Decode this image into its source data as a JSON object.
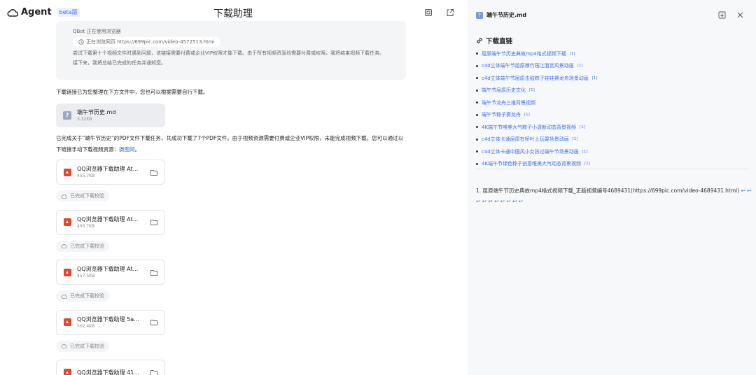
{
  "header": {
    "app_name": "Agent",
    "badge": "beta版",
    "title": "下载助理"
  },
  "chat": {
    "thought": {
      "status": "QBot 正在使用浏览器",
      "browsing": "正在浏览网页 https://699pic.com/video-4572513.html",
      "line1": "尝试下载第十个视频文件时遇到问题，该链接需要付费或企业VIP权限才能下载。由于所有视频资源均需要付费或权限，我将结束视频下载任务。",
      "line2": "接下来，我将总结已完成的任务并通知您。"
    },
    "msg1": "下载链接已为您整理在下方文件中，您也可以根据需要自行下载。",
    "file": {
      "name": "端午节历史.md",
      "size": "3.32KB"
    },
    "msg2": "已完成关于“端午节历史”的PDF文件下载任务，共成功下载了7个PDF文件。由于视频资源需要付费或企业VIP权限，未能完成视频下载。您可以通过以下链接手动下载视频资源：",
    "msg2_link": "摄图网",
    "msg2_end": "。",
    "verify_label": "已完成下载校验",
    "attachments": [
      {
        "name": "QQ浏览器下载助理 At...",
        "size": "455.7KB"
      },
      {
        "name": "QQ浏览器下载助理 At...",
        "size": "455.7KB"
      },
      {
        "name": "QQ浏览器下载助理 At...",
        "size": "457.5KB"
      },
      {
        "name": "QQ浏览器下载助理 5a...",
        "size": "502.4KB"
      },
      {
        "name": "QQ浏览器下载助理 41...",
        "size": ""
      }
    ]
  },
  "panel": {
    "title": "端午节历史.md",
    "section": "下载直链",
    "links": [
      "屈原端午节历史典故mp4格式视频下载",
      "c4d立体端午节屈原撑竹筏江面赏风景动画",
      "c4d立体端午节屈原击鼓粽子娃娃赛龙舟场景动画",
      "端午节屈原历史文化",
      "端午节龙舟三维背景视频",
      "端午节粽子赛龙舟",
      "4K端午节唯美大气粽子小清新动态背景视频",
      "c4d立体卡通屈原在桥叶上玩耍场景动画",
      "c4d立体卡通中国风小女孩过端午节场景动画",
      "4K端午节绿色粽子创意唯美大气动态背景视频"
    ],
    "ref_mark": "[1]",
    "footnote_num": "1.",
    "footnote_text": "屈原端午节历史典故mp4格式视频下载_正版视频编号4689431(https://699pic.com/video-4689431.html)",
    "footnote_returns": "↩ ↩ ↩ ↩ ↩ ↩ ↩ ↩ ↩ ↩"
  },
  "colors": {
    "accent": "#3a6fe8",
    "pdf": "#e0472e",
    "panel_bg": "#f7f8fa"
  }
}
